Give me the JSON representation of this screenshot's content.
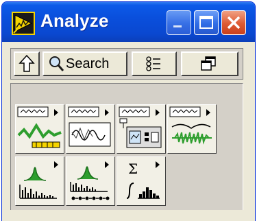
{
  "window": {
    "title": "Analyze",
    "icon": "labview-palette-icon"
  },
  "title_controls": [
    {
      "name": "minimize",
      "icon": "minimize-icon",
      "state": "disabled"
    },
    {
      "name": "maximize",
      "icon": "maximize-icon"
    },
    {
      "name": "close",
      "icon": "close-icon"
    }
  ],
  "toolbar": {
    "up_icon": "up-arrow-icon",
    "search_label": "Search",
    "view_options_icon": "view-options-icon",
    "restore_icon": "restore-palette-icon"
  },
  "palette": {
    "items": [
      {
        "icon": "waveform-measurements-icon",
        "has_submenu": true
      },
      {
        "icon": "waveform-generation-icon",
        "has_submenu": true
      },
      {
        "icon": "waveform-monitoring-icon",
        "has_submenu": true
      },
      {
        "icon": "waveform-conditioning-icon",
        "has_submenu": true
      },
      {
        "icon": "signal-processing-icon",
        "has_submenu": true
      },
      {
        "icon": "point-by-point-icon",
        "has_submenu": true
      },
      {
        "icon": "mathematics-icon",
        "has_submenu": true
      }
    ]
  },
  "colors": {
    "titlebar": "#0a4fdc",
    "close_button": "#de5a33",
    "window_face": "#ece9d8",
    "palette_face": "#d4d0c8",
    "icon_green": "#2e9e2e",
    "icon_yellow": "#f5d400"
  }
}
